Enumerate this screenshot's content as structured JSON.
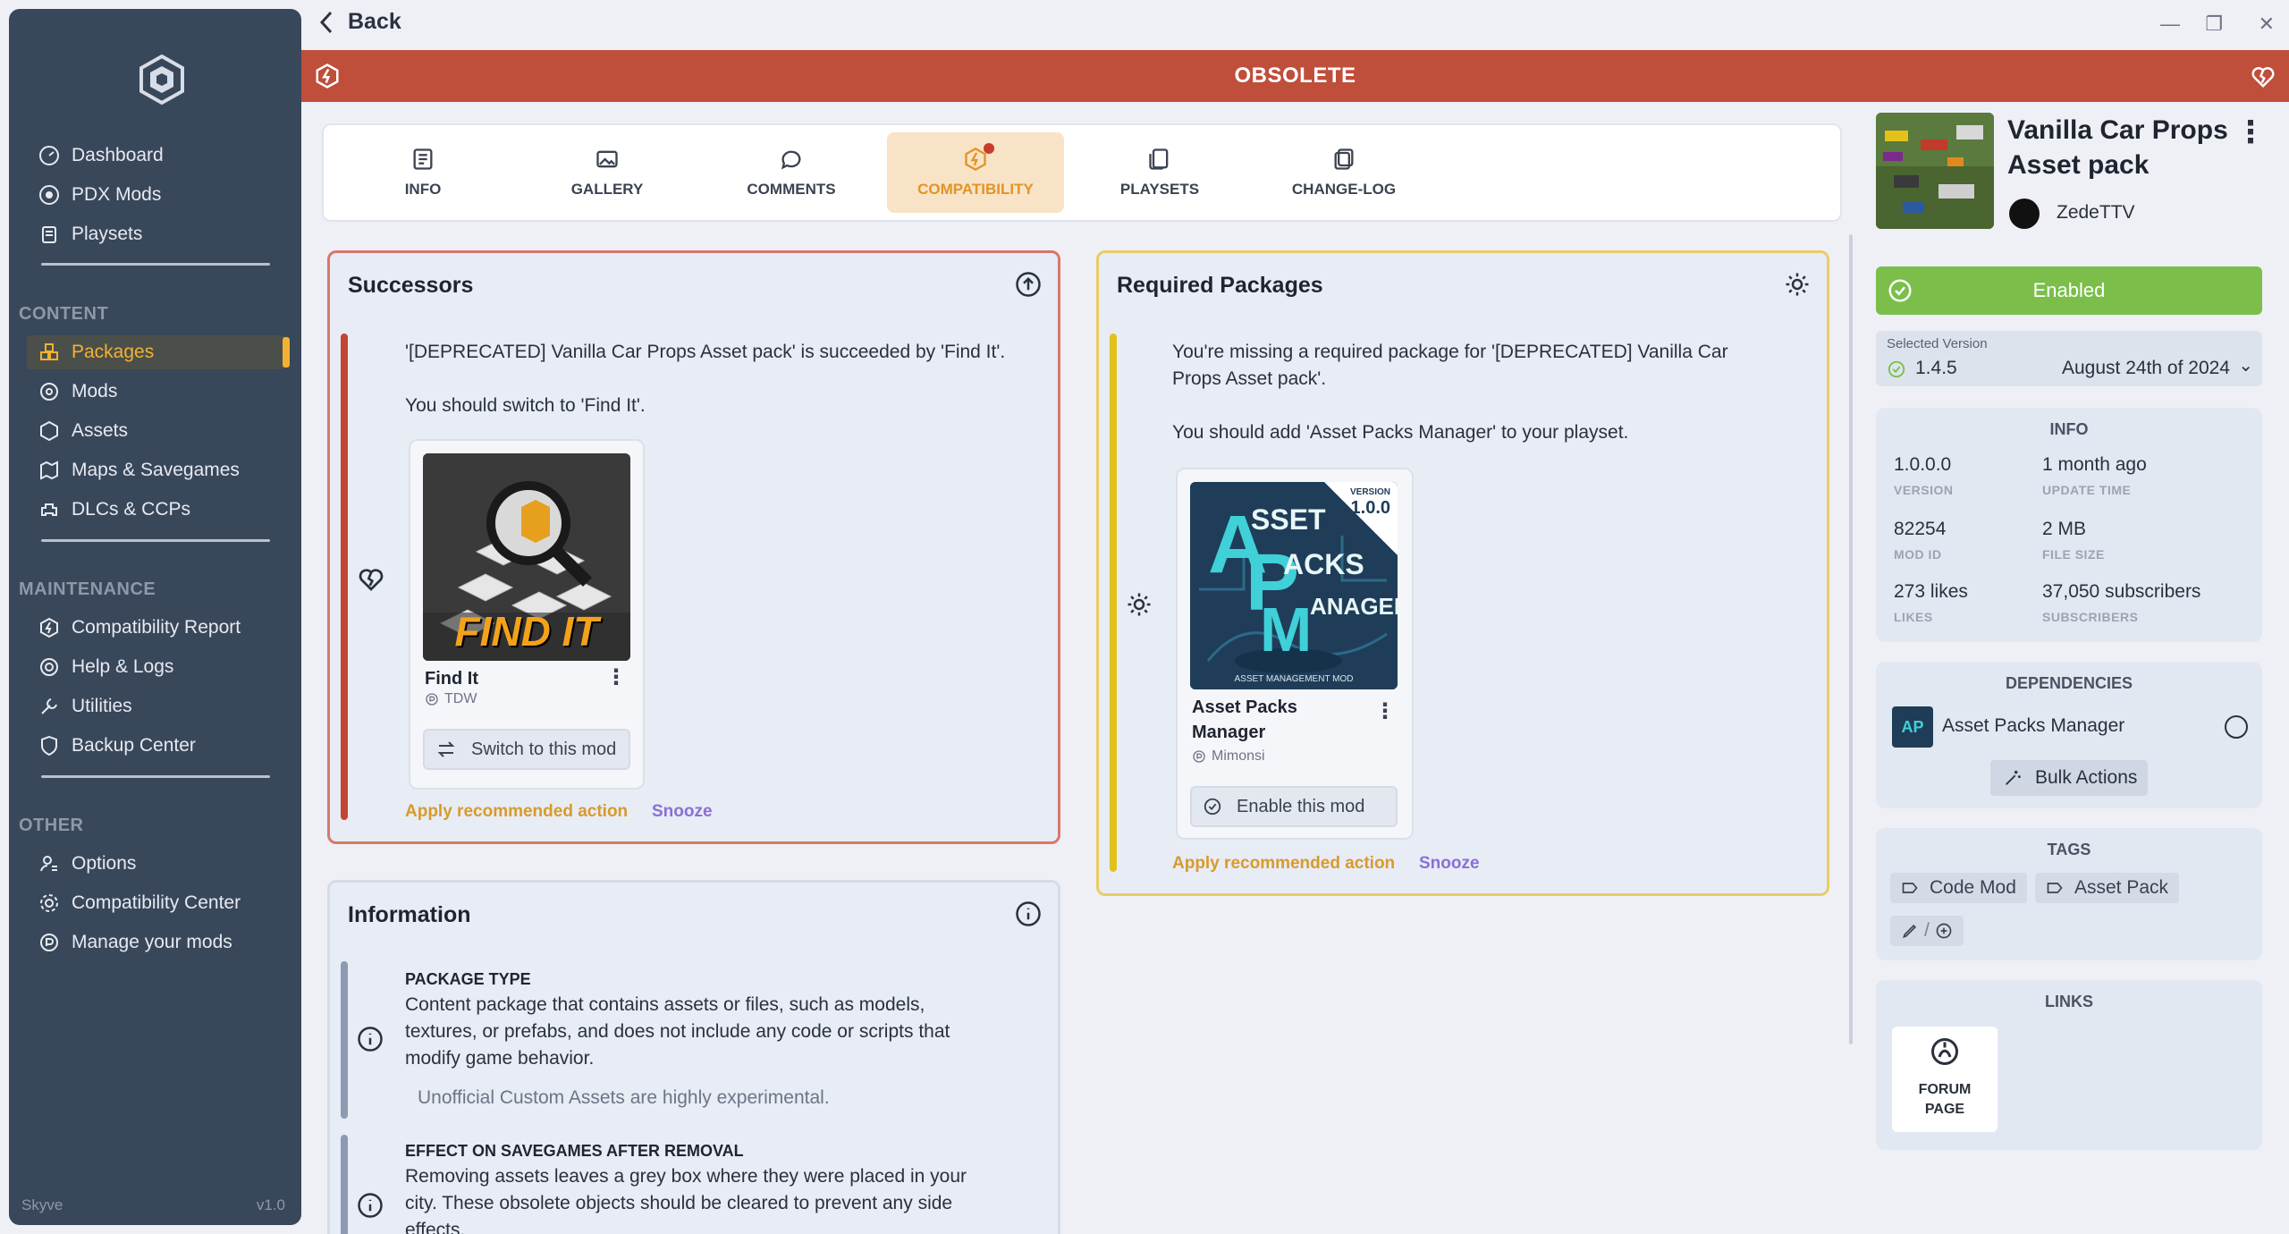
{
  "app": {
    "name": "Skyve",
    "version": "v1.0"
  },
  "sidebar": {
    "main": [
      {
        "label": "Dashboard",
        "icon": "dashboard-icon"
      },
      {
        "label": "PDX Mods",
        "icon": "paradox-icon"
      },
      {
        "label": "Playsets",
        "icon": "playsets-icon"
      }
    ],
    "content_label": "CONTENT",
    "content": [
      {
        "label": "Packages",
        "icon": "packages-icon"
      },
      {
        "label": "Mods",
        "icon": "mods-icon"
      },
      {
        "label": "Assets",
        "icon": "assets-icon"
      },
      {
        "label": "Maps & Savegames",
        "icon": "maps-icon"
      },
      {
        "label": "DLCs & CCPs",
        "icon": "dlc-icon"
      }
    ],
    "maintenance_label": "MAINTENANCE",
    "maintenance": [
      {
        "label": "Compatibility Report",
        "icon": "compatibility-icon"
      },
      {
        "label": "Help & Logs",
        "icon": "help-icon"
      },
      {
        "label": "Utilities",
        "icon": "wrench-icon"
      },
      {
        "label": "Backup Center",
        "icon": "shield-icon"
      }
    ],
    "other_label": "OTHER",
    "other": [
      {
        "label": "Options",
        "icon": "options-icon"
      },
      {
        "label": "Compatibility Center",
        "icon": "gear-icon"
      },
      {
        "label": "Manage your mods",
        "icon": "paradox-icon"
      }
    ],
    "active": "Packages"
  },
  "topbar": {
    "back_label": "Back"
  },
  "status_bar": {
    "label": "OBSOLETE",
    "color": "#bf4e3a"
  },
  "tabs": [
    {
      "label": "INFO"
    },
    {
      "label": "GALLERY"
    },
    {
      "label": "COMMENTS"
    },
    {
      "label": "COMPATIBILITY"
    },
    {
      "label": "PLAYSETS"
    },
    {
      "label": "CHANGE-LOG"
    }
  ],
  "successors": {
    "title": "Successors",
    "line1": "'[DEPRECATED] Vanilla Car Props Asset pack' is succeeded by 'Find It'.",
    "line2": "You should switch to 'Find It'.",
    "mod": {
      "name": "Find It",
      "author": "TDW",
      "thumb_text": "FIND IT",
      "action": "Switch to this mod"
    },
    "apply": "Apply recommended action",
    "snooze": "Snooze"
  },
  "required": {
    "title": "Required Packages",
    "line1a": "You're missing a required package for '[DEPRECATED] Vanilla Car",
    "line1b": "Props Asset pack'.",
    "line2": "You should add 'Asset Packs Manager' to your playset.",
    "mod": {
      "name_a": "Asset Packs",
      "name_b": "Manager",
      "author": "Mimonsi",
      "thumb_version_label": "VERSION",
      "thumb_version": "1.0.0",
      "thumb_title_a": "SSET",
      "thumb_title_b": "ACKS",
      "thumb_title_c": "ANAGER",
      "thumb_footer": "ASSET MANAGEMENT MOD",
      "action": "Enable this mod"
    },
    "apply": "Apply recommended action",
    "snooze": "Snooze"
  },
  "information": {
    "title": "Information",
    "pkg_type_head": "PACKAGE TYPE",
    "pkg_type_l1": "Content package that contains assets or files, such as models,",
    "pkg_type_l2": "textures, or prefabs, and does not include any code or scripts that",
    "pkg_type_l3": "modify game behavior.",
    "pkg_note": "Unofficial Custom Assets are highly experimental.",
    "effect_head": "EFFECT ON SAVEGAMES AFTER REMOVAL",
    "effect_l1": "Removing assets leaves a grey box where they were placed in your",
    "effect_l2": "city. These obsolete objects should be cleared to prevent any side",
    "effect_l3": "effects."
  },
  "package": {
    "title_a": "Vanilla Car Props",
    "title_b": "Asset pack",
    "author": "ZedeTTV",
    "status": "Enabled",
    "status_color": "#7bbf4a",
    "selected_version_label": "Selected Version",
    "version": "1.4.5",
    "version_date": "August 24th of 2024"
  },
  "info": {
    "head": "INFO",
    "items": [
      {
        "value": "1.0.0.0",
        "key": "VERSION"
      },
      {
        "value": "1 month ago",
        "key": "UPDATE TIME"
      },
      {
        "value": "82254",
        "key": "MOD ID"
      },
      {
        "value": "2 MB",
        "key": "FILE SIZE"
      },
      {
        "value": "273 likes",
        "key": "LIKES"
      },
      {
        "value": "37,050 subscribers",
        "key": "SUBSCRIBERS"
      }
    ]
  },
  "dependencies": {
    "head": "DEPENDENCIES",
    "item": "Asset Packs Manager",
    "bulk": "Bulk Actions"
  },
  "tags": {
    "head": "TAGS",
    "items": [
      "Code Mod",
      "Asset Pack"
    ]
  },
  "links": {
    "head": "LINKS",
    "forum_a": "FORUM",
    "forum_b": "PAGE"
  }
}
